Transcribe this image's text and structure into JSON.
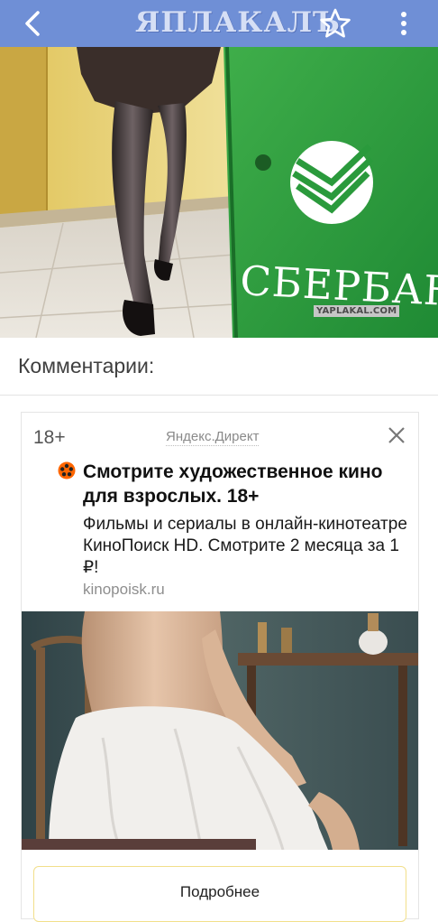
{
  "app": {
    "logo_text": "ЯПЛАКАЛЪ",
    "bar_color": "#6f8fd6",
    "icons": [
      "back-arrow-icon",
      "star-icon",
      "more-vert-icon"
    ]
  },
  "hero": {
    "sign_text": "СБЕРБАНК",
    "watermark": "YAPLAKAL.COM",
    "brand_green": "#2e9a3e"
  },
  "comments": {
    "title": "Комментарии:"
  },
  "ad": {
    "age_label": "18+",
    "source": "Яндекс.Директ",
    "headline": "Смотрите художественное кино для взрослых. 18+",
    "body": "Фильмы и сериалы в онлайн-кинотеатре КиноПоиск HD. Смотрите 2 месяца за 1 ₽!",
    "domain": "kinopoisk.ru",
    "button_label": "Подробнее",
    "icons": [
      "kinopoisk-favicon-icon",
      "close-icon"
    ],
    "button_border_color": "#f2df8a"
  }
}
